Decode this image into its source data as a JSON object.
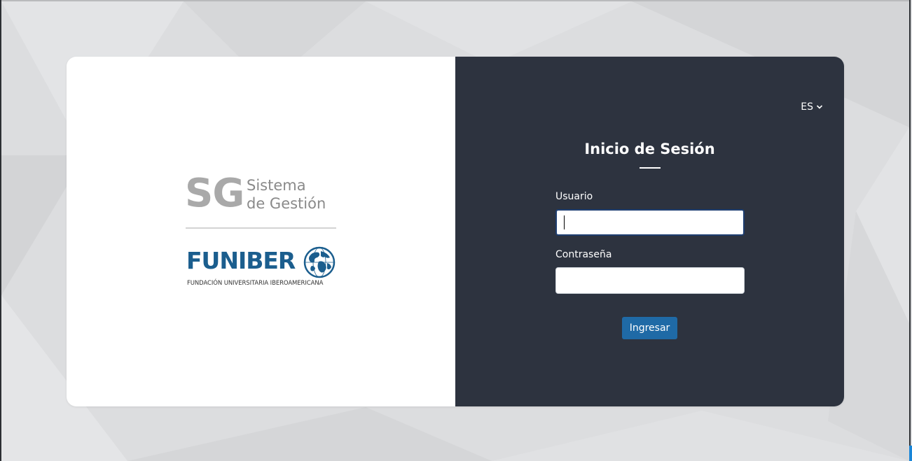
{
  "brand": {
    "sg_letters": "SG",
    "sg_line1": "Sistema",
    "sg_line2": "de Gestión",
    "funiber_name": "FUNIBER",
    "funiber_subtitle": "FUNDACIÓN UNIVERSITARIA IBEROAMERICANA"
  },
  "language": {
    "selected": "ES"
  },
  "login": {
    "title": "Inicio de Sesión",
    "username_label": "Usuario",
    "username_value": "",
    "password_label": "Contraseña",
    "password_value": "",
    "submit_label": "Ingresar"
  },
  "colors": {
    "left_panel": "#ffffff",
    "right_panel": "#2d333f",
    "button": "#1f6aa6",
    "funiber_blue": "#1b5e8e"
  },
  "icons": {
    "language_dropdown": "chevron-down-icon",
    "funiber_logo": "globe-icon"
  }
}
